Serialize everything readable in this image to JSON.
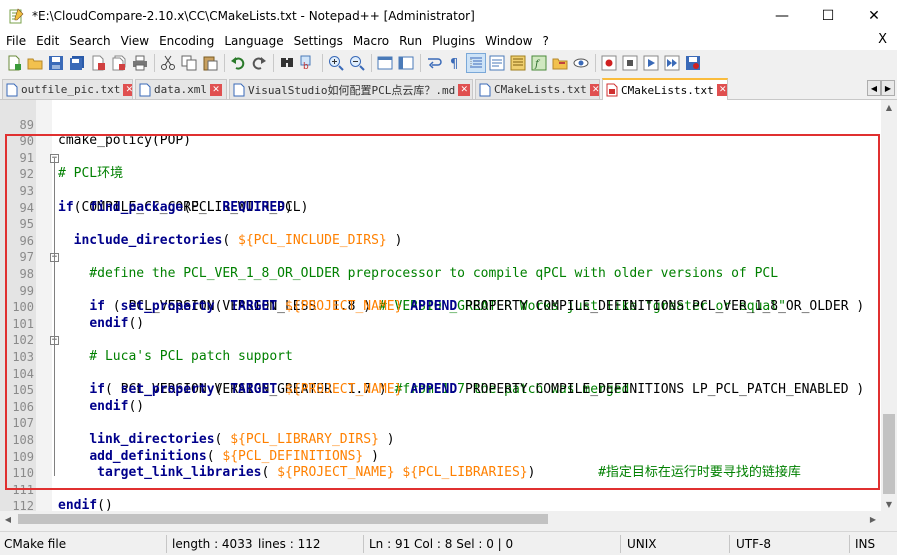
{
  "window": {
    "title": "*E:\\CloudCompare-2.10.x\\CC\\CMakeLists.txt - Notepad++ [Administrator]",
    "minimize": "—",
    "maximize": "☐",
    "close": "✕"
  },
  "menu": {
    "items": [
      "File",
      "Edit",
      "Search",
      "View",
      "Encoding",
      "Language",
      "Settings",
      "Macro",
      "Run",
      "Plugins",
      "Window",
      "?"
    ],
    "close": "X"
  },
  "tabs": [
    {
      "label": "outfile_pic.txt",
      "active": false
    },
    {
      "label": "data.xml",
      "active": false
    },
    {
      "label": "VisualStudio如何配置PCL点云库？.md",
      "active": false
    },
    {
      "label": "CMakeLists.txt",
      "active": false
    },
    {
      "label": "CMakeLists.txt",
      "active": true
    }
  ],
  "editor": {
    "lines": [
      {
        "n": "89",
        "code": "cmake_policy(POP)"
      },
      {
        "n": "90",
        "code": ""
      },
      {
        "n": "91",
        "code": "# PCL环境"
      },
      {
        "n": "92",
        "code": "if(COMPILE_CC_CORE_LIB_WITH_PCL)"
      },
      {
        "n": "93",
        "code": "    find_package(PCL REQUIRED)"
      },
      {
        "n": "94",
        "code": ""
      },
      {
        "n": "95",
        "code": "  include_directories( ${PCL_INCLUDE_DIRS} )"
      },
      {
        "n": "96",
        "code": ""
      },
      {
        "n": "97",
        "code": "    #define the PCL_VER_1_8_OR_OLDER preprocessor to compile qPCL with older versions of PCL"
      },
      {
        "n": "98",
        "code": "    if ( PCL_VERSION VERSION_LESS  1.8 ) # VERSION_GREATER Works just like \"greater or equal\""
      },
      {
        "n": "99",
        "code": "        set_property( TARGET ${PROJECT_NAME} APPEND PROPERTY COMPILE_DEFINITIONS PCL_VER_1_8_OR_OLDER )"
      },
      {
        "n": "100",
        "code": "    endif()"
      },
      {
        "n": "101",
        "code": ""
      },
      {
        "n": "102",
        "code": "    # Luca's PCL patch support"
      },
      {
        "n": "103",
        "code": "    if( PCL_VERSION VERSION_GREATER  1.7 ) #from 1.7 the patch was merged"
      },
      {
        "n": "104",
        "code": "        set_property( TARGET ${PROJECT_NAME} APPEND PROPERTY COMPILE_DEFINITIONS LP_PCL_PATCH_ENABLED )"
      },
      {
        "n": "105",
        "code": "    endif()"
      },
      {
        "n": "106",
        "code": ""
      },
      {
        "n": "107",
        "code": "    link_directories( ${PCL_LIBRARY_DIRS} )"
      },
      {
        "n": "108",
        "code": "    add_definitions( ${PCL_DEFINITIONS} )"
      },
      {
        "n": "109",
        "code": "     target_link_libraries( ${PROJECT_NAME} ${PCL_LIBRARIES})        #指定目标在运行时要寻找的链接库"
      },
      {
        "n": "110",
        "code": ""
      },
      {
        "n": "111",
        "code": "endif()"
      },
      {
        "n": "112",
        "code": ""
      }
    ]
  },
  "status": {
    "filetype": "CMake file",
    "length": "length : 4033",
    "lines": "lines : 112",
    "position": "Ln : 91    Col : 8    Sel : 0 | 0",
    "eol": "UNIX",
    "encoding": "UTF-8",
    "mode": "INS"
  },
  "colors": {
    "keyword": "#00008b",
    "comment": "#008000",
    "variable": "#ff8000",
    "highlight_box": "#e03030",
    "active_tab_accent": "#fabc3c"
  }
}
